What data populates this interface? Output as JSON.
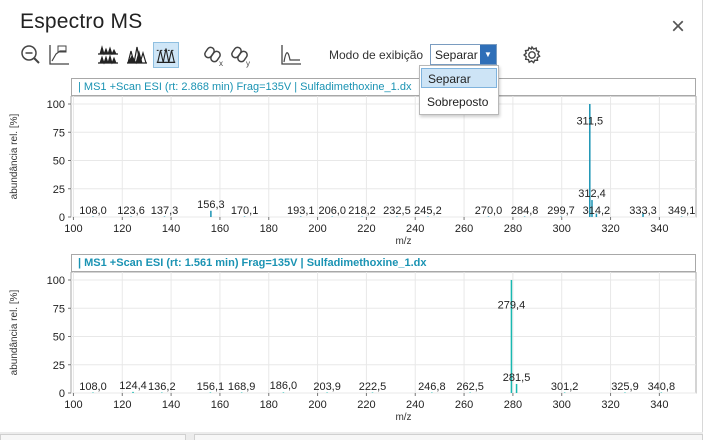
{
  "window": {
    "title": "Espectro MS",
    "close_glyph": "×"
  },
  "toolbar": {
    "icons": [
      "zoom-out-icon",
      "axis-icon",
      "stacked-peaks-icon",
      "overlay-peaks-icon",
      "normalized-peaks-icon",
      "link-x-icon",
      "link-y-icon",
      "baseline-icon",
      "settings-icon"
    ],
    "mode_label": "Modo de exibição",
    "mode_value": "Separar",
    "mode_options": [
      "Separar",
      "Sobreposto"
    ],
    "accent_color": "#2f6fb8"
  },
  "chart_data": [
    {
      "type": "bar",
      "title": "| MS1 +Scan ESI (rt: 2.868 min) Frag=135V | Sulfadimethoxine_1.dx",
      "xlabel": "m/z",
      "ylabel": "abundância rel. [%]",
      "xlim": [
        99,
        355
      ],
      "ylim": [
        0,
        100
      ],
      "xticks": [
        "100",
        "120",
        "140",
        "160",
        "180",
        "200",
        "220",
        "240",
        "260",
        "280",
        "300",
        "320",
        "340"
      ],
      "yticks": [
        "0",
        "25",
        "50",
        "75",
        "100"
      ],
      "color": "#1a93b3",
      "peaks": [
        {
          "x": 108.0,
          "y": 0.3
        },
        {
          "x": 123.6,
          "y": 0.3
        },
        {
          "x": 137.3,
          "y": 0.3
        },
        {
          "x": 156.3,
          "y": 5.5
        },
        {
          "x": 170.1,
          "y": 0.3
        },
        {
          "x": 193.1,
          "y": 0.3
        },
        {
          "x": 206.0,
          "y": 0.3
        },
        {
          "x": 218.2,
          "y": 0.3
        },
        {
          "x": 232.5,
          "y": 0.3
        },
        {
          "x": 245.2,
          "y": 0.3
        },
        {
          "x": 270.0,
          "y": 0.3
        },
        {
          "x": 284.8,
          "y": 0.3
        },
        {
          "x": 299.7,
          "y": 0.3
        },
        {
          "x": 311.5,
          "y": 100
        },
        {
          "x": 312.4,
          "y": 15
        },
        {
          "x": 314.2,
          "y": 3
        },
        {
          "x": 333.3,
          "y": 3
        },
        {
          "x": 349.1,
          "y": 0.3
        }
      ],
      "labels": [
        {
          "x": 108.0,
          "text": "108,0"
        },
        {
          "x": 123.6,
          "text": "123,6"
        },
        {
          "x": 137.3,
          "text": "137,3"
        },
        {
          "x": 156.3,
          "text": "156,3",
          "y": 5.5
        },
        {
          "x": 170.1,
          "text": "170,1"
        },
        {
          "x": 193.1,
          "text": "193,1"
        },
        {
          "x": 206.0,
          "text": "206,0"
        },
        {
          "x": 218.2,
          "text": "218,2"
        },
        {
          "x": 232.5,
          "text": "232,5"
        },
        {
          "x": 245.2,
          "text": "245,2"
        },
        {
          "x": 270.0,
          "text": "270,0"
        },
        {
          "x": 284.8,
          "text": "284,8"
        },
        {
          "x": 299.7,
          "text": "299,7"
        },
        {
          "x": 311.5,
          "text": "311,5",
          "y": 79
        },
        {
          "x": 312.4,
          "text": "312,4",
          "y": 15
        },
        {
          "x": 314.2,
          "text": "314,2"
        },
        {
          "x": 333.3,
          "text": "333,3"
        },
        {
          "x": 349.1,
          "text": "349,1"
        }
      ]
    },
    {
      "type": "bar",
      "title": "| MS1 +Scan ESI (rt: 1.561 min) Frag=135V | Sulfadimethoxine_1.dx",
      "xlabel": "m/z",
      "ylabel": "abundância rel. [%]",
      "xlim": [
        99,
        355
      ],
      "ylim": [
        0,
        100
      ],
      "xticks": [
        "100",
        "120",
        "140",
        "160",
        "180",
        "200",
        "220",
        "240",
        "260",
        "280",
        "300",
        "320",
        "340"
      ],
      "yticks": [
        "0",
        "25",
        "50",
        "75",
        "100"
      ],
      "color": "#19b8b0",
      "peaks": [
        {
          "x": 108.0,
          "y": 0.3
        },
        {
          "x": 124.4,
          "y": 1
        },
        {
          "x": 136.2,
          "y": 0.3
        },
        {
          "x": 156.1,
          "y": 0.5
        },
        {
          "x": 168.9,
          "y": 0.3
        },
        {
          "x": 186.0,
          "y": 0.5
        },
        {
          "x": 203.9,
          "y": 0.3
        },
        {
          "x": 222.5,
          "y": 0.3
        },
        {
          "x": 246.8,
          "y": 0.3
        },
        {
          "x": 262.5,
          "y": 0.3
        },
        {
          "x": 279.4,
          "y": 100
        },
        {
          "x": 281.5,
          "y": 8
        },
        {
          "x": 301.2,
          "y": 0.3
        },
        {
          "x": 325.9,
          "y": 0.3
        },
        {
          "x": 340.8,
          "y": 0.3
        }
      ],
      "labels": [
        {
          "x": 108.0,
          "text": "108,0"
        },
        {
          "x": 124.4,
          "text": "124,4",
          "y": 1
        },
        {
          "x": 136.2,
          "text": "136,2"
        },
        {
          "x": 156.1,
          "text": "156,1"
        },
        {
          "x": 168.9,
          "text": "168,9"
        },
        {
          "x": 186.0,
          "text": "186,0",
          "y": 1
        },
        {
          "x": 203.9,
          "text": "203,9"
        },
        {
          "x": 222.5,
          "text": "222,5"
        },
        {
          "x": 246.8,
          "text": "246,8"
        },
        {
          "x": 262.5,
          "text": "262,5"
        },
        {
          "x": 279.4,
          "text": "279,4",
          "y": 72
        },
        {
          "x": 281.5,
          "text": "281,5",
          "y": 8
        },
        {
          "x": 301.2,
          "text": "301,2"
        },
        {
          "x": 325.9,
          "text": "325,9"
        },
        {
          "x": 340.8,
          "text": "340,8"
        }
      ]
    }
  ]
}
